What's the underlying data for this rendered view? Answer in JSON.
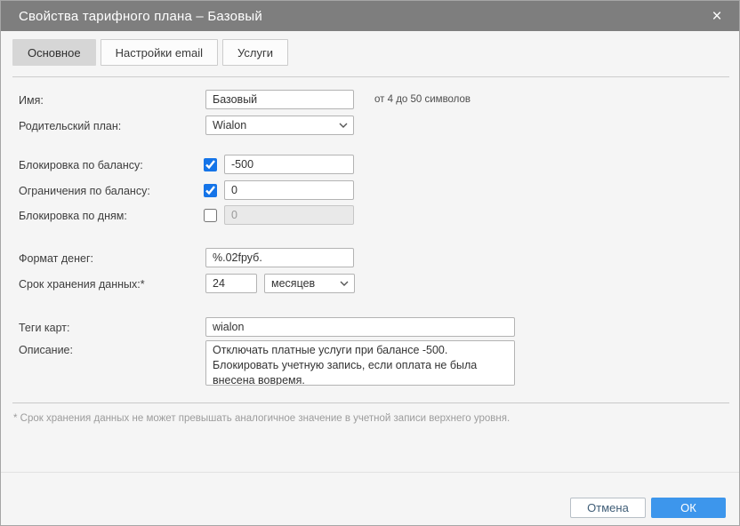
{
  "dialog": {
    "title": "Свойства тарифного плана – Базовый",
    "close_glyph": "×"
  },
  "tabs": [
    {
      "label": "Основное",
      "active": true
    },
    {
      "label": "Настройки email",
      "active": false
    },
    {
      "label": "Услуги",
      "active": false
    }
  ],
  "form": {
    "name": {
      "label": "Имя:",
      "value": "Базовый",
      "hint": "от 4 до 50 символов"
    },
    "parent_plan": {
      "label": "Родительский план:",
      "value": "Wialon"
    },
    "block_balance": {
      "label": "Блокировка по балансу:",
      "checked": true,
      "value": "-500"
    },
    "limit_balance": {
      "label": "Ограничения по балансу:",
      "checked": true,
      "value": "0"
    },
    "block_days": {
      "label": "Блокировка по дням:",
      "checked": false,
      "value": "0",
      "disabled": true
    },
    "money_format": {
      "label": "Формат денег:",
      "value": "%.02fруб."
    },
    "storage_period": {
      "label": "Срок хранения данных:*",
      "value": "24",
      "unit": "месяцев"
    },
    "card_tags": {
      "label": "Теги карт:",
      "value": "wialon"
    },
    "description": {
      "label": "Описание:",
      "value": "Отключать платные услуги при балансе -500. Блокировать учетную запись, если оплата не была внесена вовремя."
    }
  },
  "footnote": "* Срок хранения данных не может превышать аналогичное значение в учетной записи верхнего уровня.",
  "buttons": {
    "cancel": "Отмена",
    "ok": "ОК"
  },
  "colors": {
    "titlebar": "#7e7e7e",
    "checkbox_blue": "#1574e8",
    "ok_button_blue": "#3d96ec",
    "active_tab_gray": "#d6d6d6",
    "dialog_background": "#f5f5f5"
  }
}
